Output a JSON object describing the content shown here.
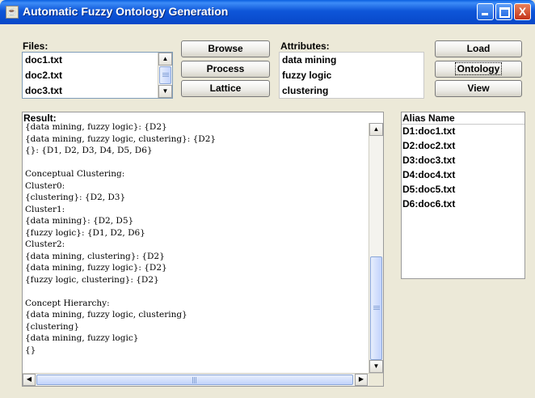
{
  "window": {
    "title": "Automatic Fuzzy Ontology Generation",
    "close_glyph": "X"
  },
  "files": {
    "label": "Files:",
    "items": [
      "doc1.txt",
      "doc2.txt",
      "doc3.txt"
    ]
  },
  "buttons_left": {
    "browse": "Browse",
    "process": "Process",
    "lattice": "Lattice"
  },
  "attributes": {
    "label": "Attributes:",
    "items": [
      "data mining",
      "fuzzy logic",
      "clustering"
    ]
  },
  "buttons_right": {
    "load": "Load",
    "ontology": "Ontology",
    "view": "View"
  },
  "result": {
    "label": "Result:",
    "lines": [
      "{data mining, fuzzy logic}: {D2}",
      "{data mining, fuzzy logic, clustering}: {D2}",
      "{}: {D1, D2, D3, D4, D5, D6}",
      "",
      "Conceptual Clustering:",
      "Cluster0:",
      "{clustering}: {D2, D3}",
      "Cluster1:",
      "{data mining}: {D2, D5}",
      "{fuzzy logic}: {D1, D2, D6}",
      "Cluster2:",
      "{data mining, clustering}: {D2}",
      "{data mining, fuzzy logic}: {D2}",
      "{fuzzy logic, clustering}: {D2}",
      "",
      "Concept Hierarchy:",
      "{data mining, fuzzy logic, clustering}",
      "{clustering}",
      "{data mining, fuzzy logic}",
      "{}"
    ]
  },
  "alias": {
    "header": "Alias Name",
    "items": [
      "D1:doc1.txt",
      "D2:doc2.txt",
      "D3:doc3.txt",
      "D4:doc4.txt",
      "D5:doc5.txt",
      "D6:doc6.txt"
    ]
  },
  "icons": {
    "scroll_up": "▲",
    "scroll_down": "▼",
    "scroll_left": "◀",
    "scroll_right": "▶"
  }
}
